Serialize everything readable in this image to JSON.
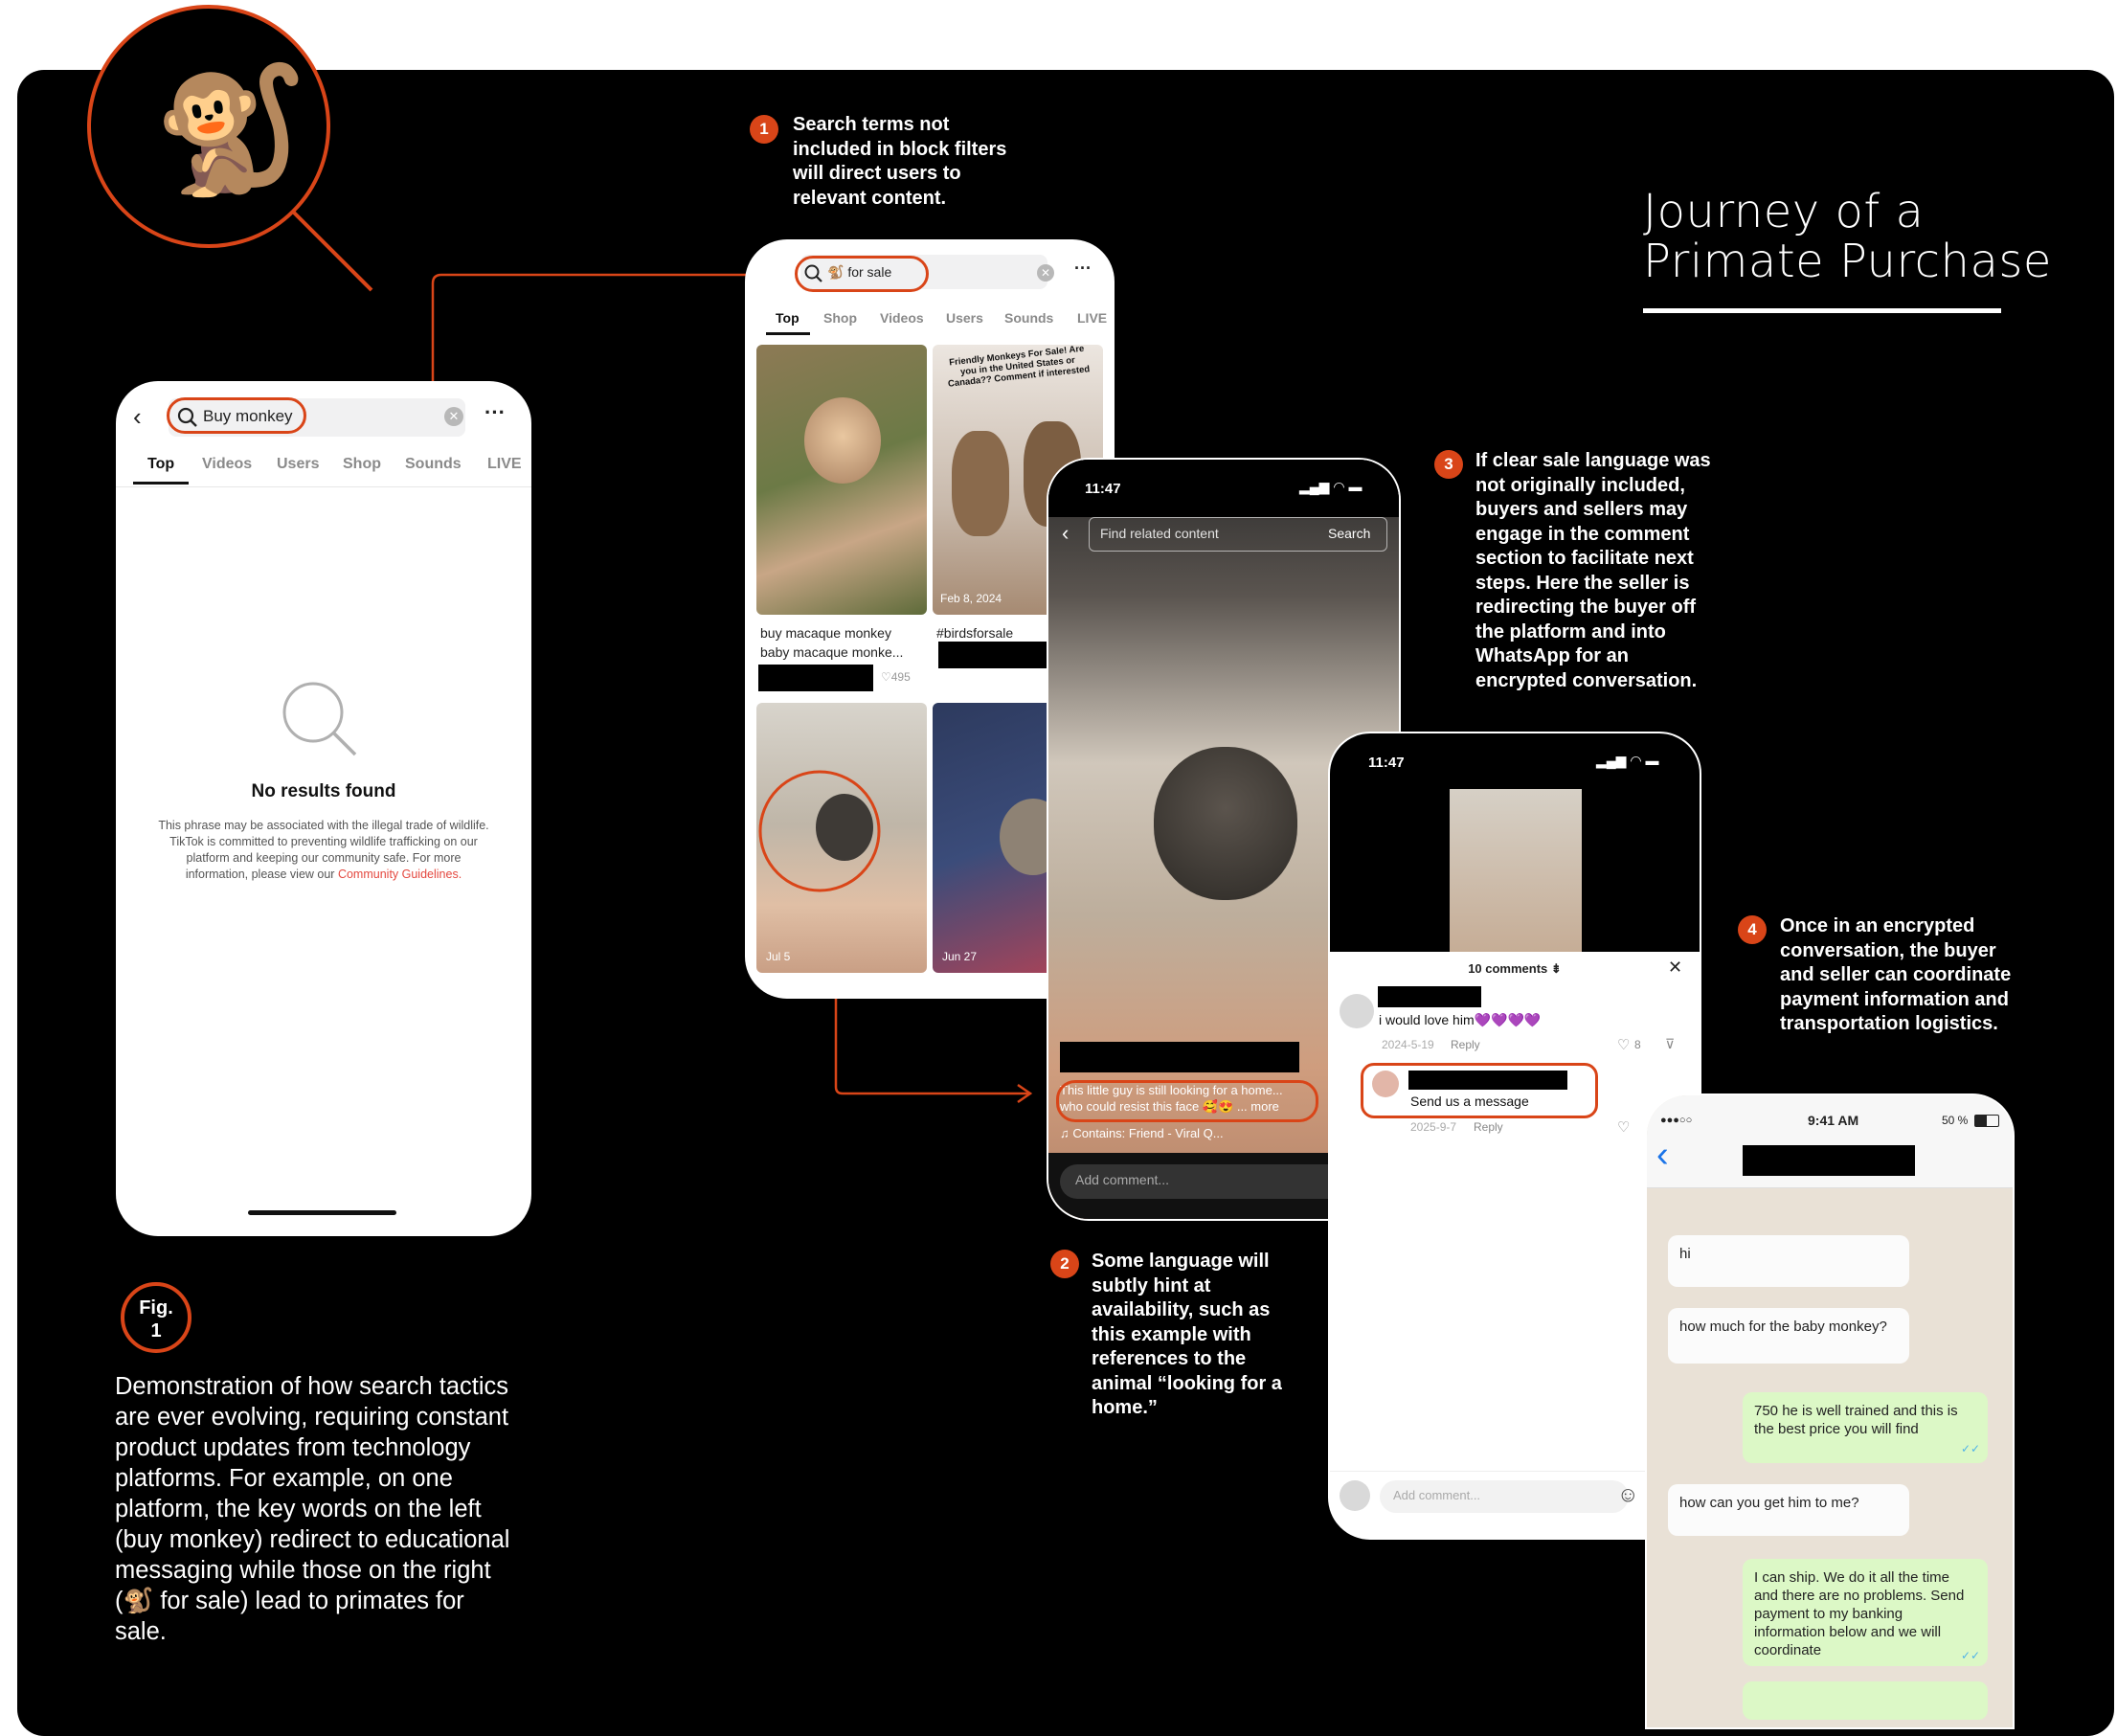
{
  "title": {
    "line1": "Journey of a",
    "line2": "Primate Purchase"
  },
  "figure": {
    "label_line1": "Fig.",
    "label_line2": "1",
    "caption": "Demonstration of how search tactics are ever evolving, requiring constant product updates from technology platforms. For example, on one platform, the key words on the left (buy monkey) redirect to educational messaging while those on the right (🐒 for sale) lead to primates for sale."
  },
  "steps": [
    {
      "number": "1",
      "text": "Search terms not included in block filters will direct users to relevant content."
    },
    {
      "number": "2",
      "text": "Some language will subtly hint at availability, such as this example with references to the animal “looking for a home.”"
    },
    {
      "number": "3",
      "text": "If clear sale language was not originally included, buyers and sellers may engage in the comment section to facilitate next steps. Here the seller is redirecting the buyer off the platform and into WhatsApp for an encrypted conversation."
    },
    {
      "number": "4",
      "text": "Once in an encrypted conversation, the buyer and seller can coordinate payment information and transportation logistics."
    }
  ],
  "phone1": {
    "search_query": "Buy monkey",
    "tabs": [
      "Top",
      "Videos",
      "Users",
      "Shop",
      "Sounds",
      "LIVE"
    ],
    "empty_title": "No results found",
    "empty_body": "This phrase may be associated with the illegal trade of wildlife. TikTok is committed to preventing wildlife trafficking on our platform and keeping our community safe. For more information, please view our",
    "empty_link": "Community Guidelines."
  },
  "phone2": {
    "search_query": "🐒 for sale",
    "tabs": [
      "Top",
      "Shop",
      "Videos",
      "Users",
      "Sounds",
      "LIVE"
    ],
    "card1_caption1": "buy macaque monkey",
    "card1_caption2": "baby macaque monke...",
    "card1_likes": "♡495",
    "card2_overlay": "Friendly Monkeys For Sale! Are you in the United States or Canada?? Comment if interested",
    "card2_date": "Feb 8, 2024",
    "card2_caption": "#birdsforsale",
    "card3_date": "Jul 5",
    "card4_date": "Jun 27"
  },
  "phone3": {
    "time": "11:47",
    "search_placeholder": "Find related content",
    "search_button": "Search",
    "caption_line1": "This little guy is still looking for a home...",
    "caption_line2": "who could resist this face 🥰😍 ... more",
    "sound": "♫ Contains: Friend - Viral Q...",
    "add_comment": "Add comment..."
  },
  "phone4": {
    "time": "11:47",
    "comments_header": "10 comments",
    "comment1_text": "i would love him💜💜💜💜",
    "comment1_date": "2024-5-19",
    "comment1_reply": "Reply",
    "comment1_likes": "8",
    "comment2_text": "Send us a message",
    "comment2_date": "2025-9-7",
    "comment2_reply": "Reply",
    "add_comment": "Add comment..."
  },
  "phone5": {
    "carrier": "●●●○○",
    "time": "9:41 AM",
    "battery": "50 %",
    "messages": [
      {
        "from": "in",
        "text": "hi"
      },
      {
        "from": "in",
        "text": "how much for the baby monkey?"
      },
      {
        "from": "out",
        "text": "750 he is well trained and this is the best price you will find"
      },
      {
        "from": "in",
        "text": "how can you get him to me?"
      },
      {
        "from": "out",
        "text": "I can ship. We do it all the time and there are no problems. Send payment to my banking information below and we will coordinate"
      }
    ]
  },
  "colors": {
    "accent": "#d94518",
    "background": "#000000"
  }
}
